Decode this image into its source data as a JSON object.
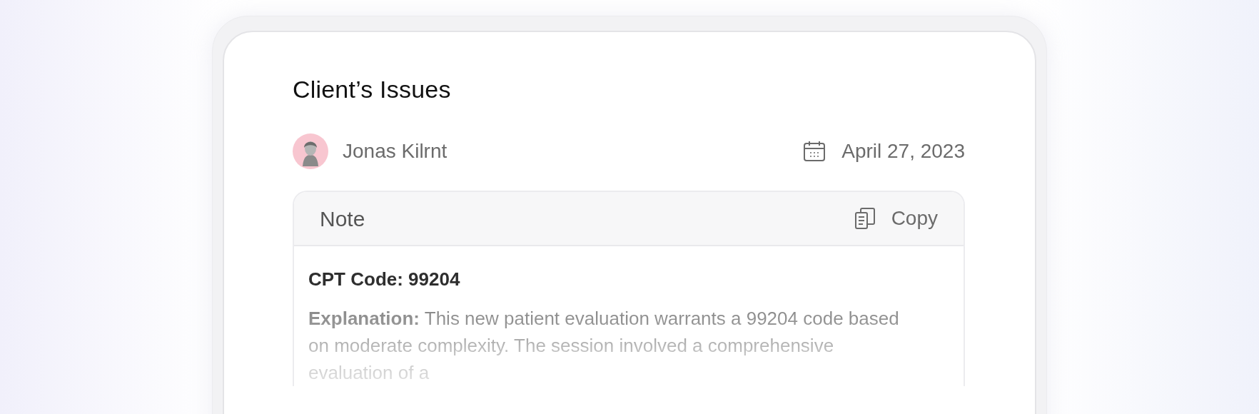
{
  "card": {
    "title": "Client’s Issues",
    "author": {
      "name": "Jonas Kilrnt"
    },
    "date": "April 27, 2023",
    "note": {
      "label": "Note",
      "copy_button": "Copy",
      "heading": "CPT Code: 99204",
      "body": "**Explanation:** This new patient evaluation warrants a 99204 code based on moderate complexity. The session involved a comprehensive evaluation of a"
    }
  }
}
